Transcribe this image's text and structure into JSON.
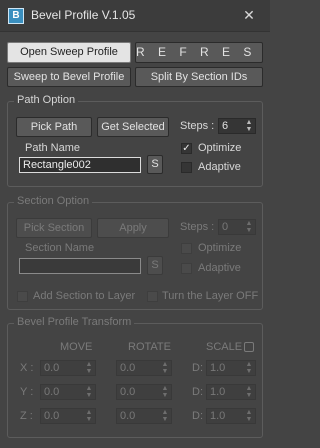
{
  "window": {
    "title": "Bevel Profile V.1.05",
    "app_icon_glyph": "B",
    "close_glyph": "✕"
  },
  "top_buttons": {
    "open_sweep": "Open Sweep Profile",
    "refresh": "R E F R E S H",
    "sweep_to_bevel": "Sweep to Bevel Profile",
    "split_by_section": "Split By Section IDs"
  },
  "path_option": {
    "title": "Path Option",
    "pick_path": "Pick Path",
    "get_selected": "Get Selected",
    "steps_label": "Steps :",
    "steps_value": "6",
    "path_name_label": "Path Name",
    "path_name_value": "Rectangle002",
    "s_button": "S",
    "optimize_label": "Optimize",
    "optimize_checked": true,
    "adaptive_label": "Adaptive",
    "adaptive_checked": false
  },
  "section_option": {
    "title": "Section Option",
    "pick_section": "Pick Section",
    "apply": "Apply",
    "steps_label": "Steps :",
    "steps_value": "0",
    "section_name_label": "Section Name",
    "section_name_value": "",
    "s_button": "S",
    "optimize_label": "Optimize",
    "adaptive_label": "Adaptive",
    "add_section_label": "Add Section to Layer",
    "turn_layer_off_label": "Turn the Layer OFF"
  },
  "transform": {
    "title": "Bevel Profile Transform",
    "move_header": "MOVE",
    "rotate_header": "ROTATE",
    "scale_header": "SCALE",
    "rows": [
      {
        "axis": "X :",
        "move": "0.0",
        "rotate": "0.0",
        "d_label": "D:",
        "scale": "1.0"
      },
      {
        "axis": "Y :",
        "move": "0.0",
        "rotate": "0.0",
        "d_label": "D:",
        "scale": "1.0"
      },
      {
        "axis": "Z :",
        "move": "0.0",
        "rotate": "0.0",
        "d_label": "D:",
        "scale": "1.0"
      }
    ]
  }
}
